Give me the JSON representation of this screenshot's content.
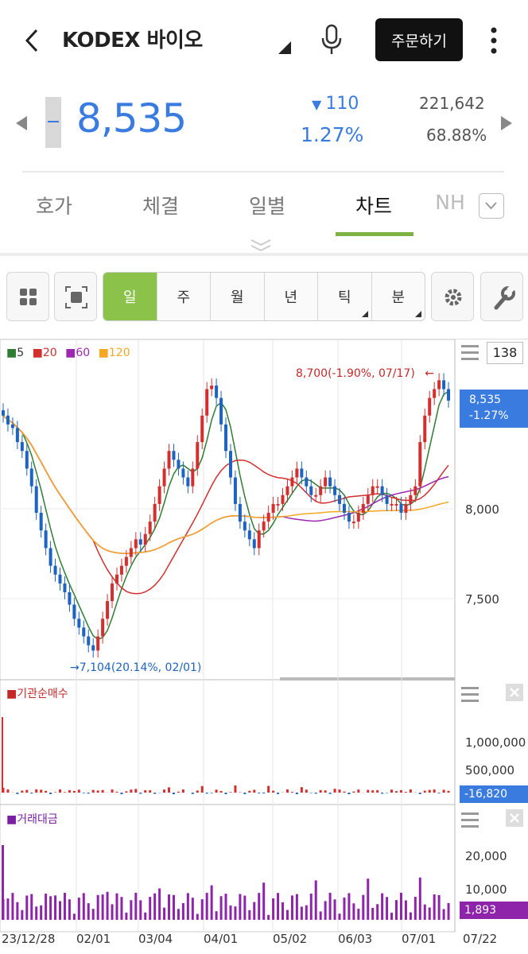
{
  "header": {
    "title": "KODEX 바이오",
    "order_button": "주문하기"
  },
  "quote": {
    "price": "8,535",
    "change": "110",
    "change_pct": "1.27%",
    "volume": "221,642",
    "rate": "68.88%"
  },
  "tabs": [
    "호가",
    "체결",
    "일별",
    "차트",
    "NH"
  ],
  "periods": [
    "일",
    "주",
    "월",
    "년",
    "틱",
    "분"
  ],
  "chart": {
    "count": "138",
    "legend": [
      {
        "label": "5",
        "color": "#2e7d32"
      },
      {
        "label": "20",
        "color": "#d32f2f"
      },
      {
        "label": "60",
        "color": "#9c27b0"
      },
      {
        "label": "120",
        "color": "#f5a623"
      }
    ],
    "high_note": "8,700(-1.90%, 07/17)",
    "low_note": "7,104(20.14%, 02/01)",
    "price_tag": "8,535",
    "price_tag_pct": "-1.27%",
    "y_ticks": [
      "8,000",
      "7,500"
    ],
    "inst_title": "기관순매수",
    "inst_ticks": [
      "1,000,000",
      "500,000"
    ],
    "inst_tag": "-16,820",
    "amt_title": "거래대금",
    "amt_ticks": [
      "20,000",
      "10,000"
    ],
    "amt_tag": "1,893",
    "x_ticks": [
      "23/12/28",
      "02/01",
      "03/04",
      "04/01",
      "05/02",
      "06/03",
      "07/01",
      "07/22"
    ]
  },
  "chart_data": {
    "type": "candlestick",
    "y_range": [
      7000,
      8800
    ],
    "closes": [
      8450,
      8400,
      8380,
      8300,
      8250,
      8150,
      8050,
      7900,
      7800,
      7700,
      7600,
      7550,
      7500,
      7450,
      7380,
      7300,
      7250,
      7200,
      7150,
      7120,
      7200,
      7300,
      7400,
      7500,
      7550,
      7600,
      7650,
      7700,
      7750,
      7720,
      7780,
      7850,
      7950,
      8050,
      8150,
      8250,
      8200,
      8150,
      8100,
      8050,
      8150,
      8300,
      8450,
      8600,
      8620,
      8550,
      8400,
      8250,
      8100,
      7950,
      7850,
      7800,
      7750,
      7700,
      7800,
      7850,
      7900,
      7950,
      7950,
      8000,
      8050,
      8100,
      8150,
      8100,
      8050,
      8000,
      8000,
      8050,
      8100,
      8050,
      8000,
      7950,
      7900,
      7850,
      7850,
      7900,
      7950,
      8000,
      8050,
      8050,
      8000,
      7950,
      7950,
      7950,
      7900,
      7950,
      8000,
      8050,
      8300,
      8450,
      8550,
      8600,
      8650,
      8600,
      8535
    ]
  }
}
